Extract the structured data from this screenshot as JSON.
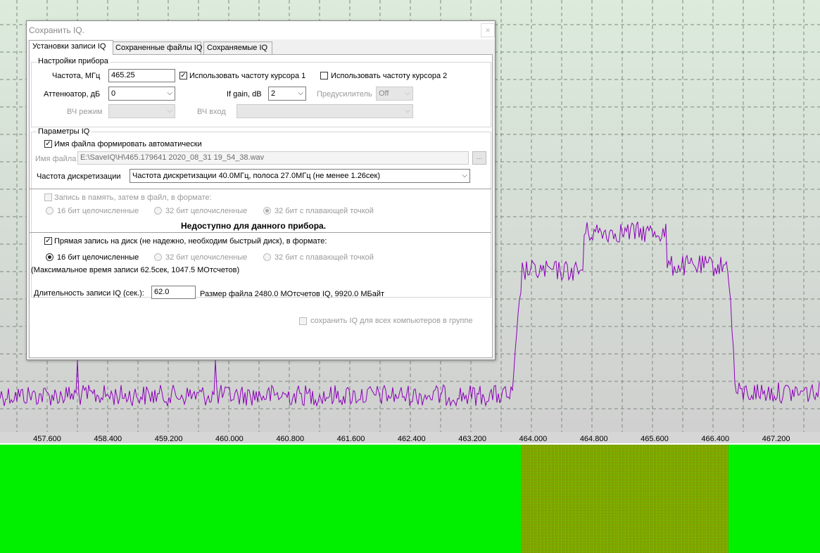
{
  "spectrum": {
    "x_labels": [
      "457.600",
      "458.400",
      "459.200",
      "460.000",
      "460.800",
      "461.600",
      "462.400",
      "463.200",
      "464.000",
      "464.800",
      "465.600",
      "466.400",
      "467.200"
    ],
    "trace_color": "#8a00b8",
    "background_color": "#dde8dd"
  },
  "waterfall": {
    "background_color": "#00f000"
  },
  "dialog": {
    "title": "Сохранить IQ.",
    "close_label": "×",
    "tabs": [
      {
        "label": "Установки записи IQ",
        "active": true
      },
      {
        "label": "Сохраненные файлы IQ",
        "active": false
      },
      {
        "label": "Сохраняемые IQ",
        "active": false
      }
    ],
    "device_settings": {
      "group_label": "Настройки прибора",
      "frequency_label": "Частота, МГц",
      "frequency_value": "465.25",
      "use_cursor1_label": "Использовать частоту курсора 1",
      "use_cursor1_checked": true,
      "use_cursor2_label": "Использовать частоту курсора 2",
      "use_cursor2_checked": false,
      "attenuator_label": "Аттенюатор, дБ",
      "attenuator_value": "0",
      "if_gain_label": "If gain, dB",
      "if_gain_value": "2",
      "preamp_label": "Предусилитель",
      "preamp_value": "Off",
      "rf_mode_label": "ВЧ режим",
      "rf_mode_value": "",
      "rf_input_label": "ВЧ вход",
      "rf_input_value": ""
    },
    "iq_params": {
      "group_label": "Параметры IQ",
      "auto_filename_label": "Имя файла формировать автоматически",
      "auto_filename_checked": true,
      "filename_label": "Имя файла",
      "filename_value": "E:\\SaveIQ\\H\\465.179641 2020_08_31  19_54_38.wav",
      "browse_label": "...",
      "sample_rate_label": "Частота дискретизации",
      "sample_rate_value": "Частота дискретизации 40.0МГц, полоса 27.0МГц (не менее 1.26сек)"
    },
    "memory_record": {
      "label": "Запись в память, затем в файл, в формате:",
      "checked": false,
      "formats": [
        "16 бит целочисленные",
        "32 бит целочисленные",
        "32 бит с плавающей точкой"
      ],
      "selected_index": 2,
      "unavailable_note": "Недоступно для данного прибора."
    },
    "disk_record": {
      "label": "Прямая запись на диск (не надежно, необходим быстрый диск), в формате:",
      "checked": true,
      "formats": [
        "16 бит целочисленные",
        "32 бит целочисленные",
        "32 бит с плавающей точкой"
      ],
      "selected_index": 0,
      "max_time_note": "(Максимальное время записи 62.5сек, 1047.5 МОтсчетов)"
    },
    "duration": {
      "label": "Длительность записи IQ (сек.):",
      "value": "62.0",
      "file_size_note": "Размер файла 2480.0 МОтсчетов IQ, 9920.0 МБайт"
    },
    "save_all_group": {
      "label": "сохранить IQ для всех компьютеров в группе",
      "checked": false
    }
  }
}
